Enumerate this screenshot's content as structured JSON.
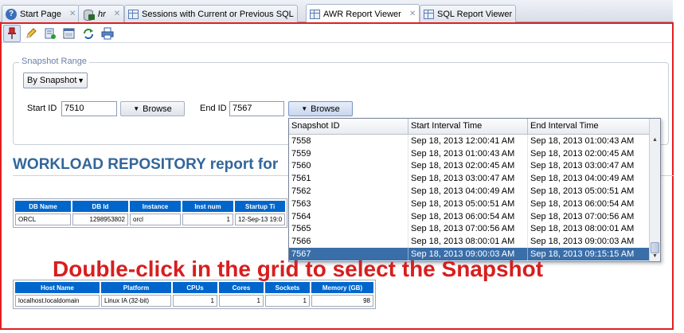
{
  "tabs": [
    {
      "label": "Start Page",
      "icon": "help-icon",
      "italic": false,
      "active": false,
      "closable": true
    },
    {
      "label": "hr",
      "icon": "database-connection-icon",
      "italic": true,
      "active": false,
      "closable": true
    },
    {
      "label": "Sessions with Current or Previous SQL",
      "icon": "grid-report-icon",
      "italic": false,
      "active": false,
      "closable": false
    },
    {
      "label": "AWR Report Viewer",
      "icon": "grid-report-icon",
      "italic": false,
      "active": true,
      "closable": true
    },
    {
      "label": "SQL Report Viewer",
      "icon": "grid-report-icon",
      "italic": false,
      "active": false,
      "closable": false
    }
  ],
  "close_glyph": "✕",
  "toolbar": {
    "buttons": [
      "pin-icon",
      "edit-icon",
      "run-report-icon",
      "sql-icon",
      "refresh-icon",
      "print-icon"
    ]
  },
  "snapshot_range": {
    "legend": "Snapshot Range",
    "mode": "By Snapshot",
    "start_label": "Start ID",
    "start_value": "7510",
    "end_label": "End ID",
    "end_value": "7567",
    "browse_label": "Browse"
  },
  "report": {
    "title": "WORKLOAD REPOSITORY report for",
    "table1": {
      "headers": [
        "DB Name",
        "DB Id",
        "Instance",
        "Inst num",
        "Startup Ti"
      ],
      "row": [
        "ORCL",
        "1298953802",
        "orcl",
        "1",
        "12-Sep-13 19:0"
      ]
    },
    "table2": {
      "headers": [
        "Host Name",
        "Platform",
        "CPUs",
        "Cores",
        "Sockets",
        "Memory (GB)"
      ],
      "row": [
        "localhost.localdomain",
        "Linux IA (32-bit)",
        "1",
        "1",
        "1",
        "98"
      ]
    }
  },
  "snapshot_grid": {
    "headers": [
      "Snapshot ID",
      "Start Interval Time",
      "End Interval Time"
    ],
    "rows": [
      [
        "7558",
        "Sep 18, 2013 12:00:41 AM",
        "Sep 18, 2013 01:00:43 AM"
      ],
      [
        "7559",
        "Sep 18, 2013 01:00:43 AM",
        "Sep 18, 2013 02:00:45 AM"
      ],
      [
        "7560",
        "Sep 18, 2013 02:00:45 AM",
        "Sep 18, 2013 03:00:47 AM"
      ],
      [
        "7561",
        "Sep 18, 2013 03:00:47 AM",
        "Sep 18, 2013 04:00:49 AM"
      ],
      [
        "7562",
        "Sep 18, 2013 04:00:49 AM",
        "Sep 18, 2013 05:00:51 AM"
      ],
      [
        "7563",
        "Sep 18, 2013 05:00:51 AM",
        "Sep 18, 2013 06:00:54 AM"
      ],
      [
        "7564",
        "Sep 18, 2013 06:00:54 AM",
        "Sep 18, 2013 07:00:56 AM"
      ],
      [
        "7565",
        "Sep 18, 2013 07:00:56 AM",
        "Sep 18, 2013 08:00:01 AM"
      ],
      [
        "7566",
        "Sep 18, 2013 08:00:01 AM",
        "Sep 18, 2013 09:00:03 AM"
      ],
      [
        "7567",
        "Sep 18, 2013 09:00:03 AM",
        "Sep 18, 2013 09:15:15 AM"
      ]
    ],
    "selected_id": "7567"
  },
  "callout": "Double-click in the grid to select the Snapshot",
  "colors": {
    "accent_frame": "#e02020",
    "callout": "#d81e1e",
    "report_title": "#336699",
    "table_header": "#0066cc",
    "selection": "#3a6ea8"
  }
}
